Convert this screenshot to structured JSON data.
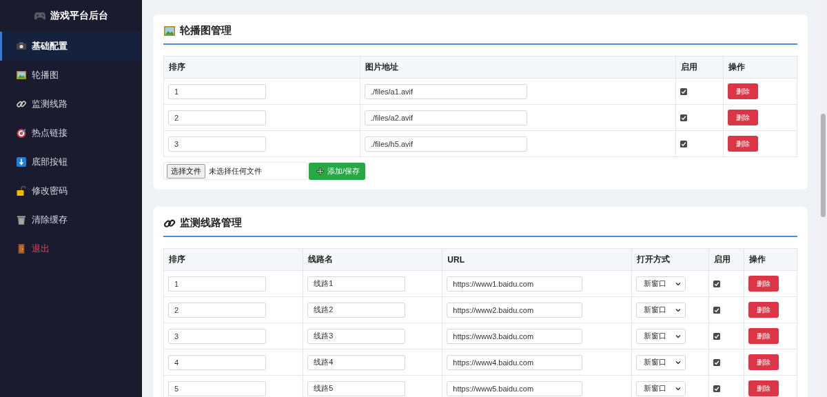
{
  "sidebar": {
    "title": "游戏平台后台",
    "items": [
      {
        "label": "基础配置",
        "selected": true,
        "kind": "nav"
      },
      {
        "label": "轮播图",
        "selected": false,
        "kind": "nav"
      },
      {
        "label": "监测线路",
        "selected": false,
        "kind": "nav"
      },
      {
        "label": "热点链接",
        "selected": false,
        "kind": "nav"
      },
      {
        "label": "底部按钮",
        "selected": false,
        "kind": "nav"
      },
      {
        "label": "修改密码",
        "selected": false,
        "kind": "nav"
      },
      {
        "label": "清除缓存",
        "selected": false,
        "kind": "nav"
      },
      {
        "label": "退出",
        "selected": false,
        "kind": "logout"
      }
    ]
  },
  "carousel": {
    "title": "轮播图管理",
    "columns": [
      "排序",
      "图片地址",
      "启用",
      "操作"
    ],
    "rows": [
      {
        "order": "1",
        "path": "./files/a1.avif",
        "enabled": true,
        "action": "删除"
      },
      {
        "order": "2",
        "path": "./files/a2.avif",
        "enabled": true,
        "action": "删除"
      },
      {
        "order": "3",
        "path": "./files/h5.avif",
        "enabled": true,
        "action": "删除"
      }
    ],
    "file_button": "选择文件",
    "file_status": "未选择任何文件",
    "add_button": "添加/保存"
  },
  "lines": {
    "title": "监测线路管理",
    "columns": [
      "排序",
      "线路名",
      "URL",
      "打开方式",
      "启用",
      "操作"
    ],
    "rows": [
      {
        "order": "1",
        "name": "线路1",
        "url": "https://www1.baidu.com",
        "open_mode": "新窗口",
        "enabled": true,
        "action": "删除"
      },
      {
        "order": "2",
        "name": "线路2",
        "url": "https://www2.baidu.com",
        "open_mode": "新窗口",
        "enabled": true,
        "action": "删除"
      },
      {
        "order": "3",
        "name": "线路3",
        "url": "https://www3.baidu.com",
        "open_mode": "新窗口",
        "enabled": true,
        "action": "删除"
      },
      {
        "order": "4",
        "name": "线路4",
        "url": "https://www4.baidu.com",
        "open_mode": "新窗口",
        "enabled": true,
        "action": "删除"
      },
      {
        "order": "5",
        "name": "线路5",
        "url": "https://www5.baidu.com",
        "open_mode": "新窗口",
        "enabled": true,
        "action": "删除"
      }
    ]
  }
}
